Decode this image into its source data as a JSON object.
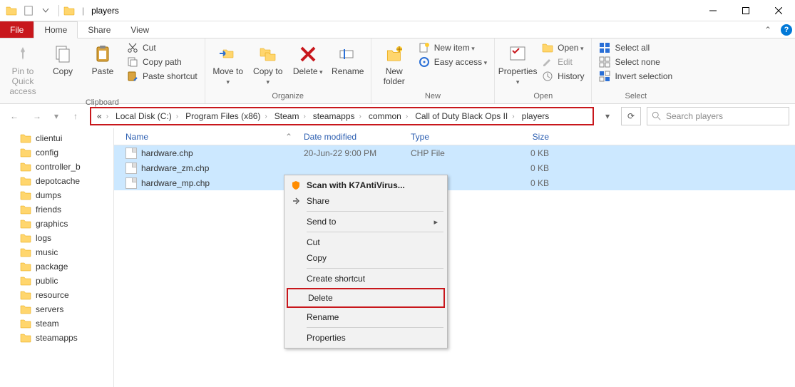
{
  "window": {
    "title": "players",
    "title_sep": "|"
  },
  "tabs": {
    "file": "File",
    "home": "Home",
    "share": "Share",
    "view": "View"
  },
  "ribbon": {
    "clipboard": {
      "label": "Clipboard",
      "pin": "Pin to Quick access",
      "copy": "Copy",
      "paste": "Paste",
      "cut": "Cut",
      "copy_path": "Copy path",
      "paste_shortcut": "Paste shortcut"
    },
    "organize": {
      "label": "Organize",
      "move_to": "Move to",
      "copy_to": "Copy to",
      "delete": "Delete",
      "rename": "Rename"
    },
    "new": {
      "label": "New",
      "new_folder": "New folder",
      "new_item": "New item",
      "easy_access": "Easy access"
    },
    "open": {
      "label": "Open",
      "properties": "Properties",
      "open": "Open",
      "edit": "Edit",
      "history": "History"
    },
    "select": {
      "label": "Select",
      "select_all": "Select all",
      "select_none": "Select none",
      "invert": "Invert selection"
    }
  },
  "breadcrumbs": [
    "Local Disk (C:)",
    "Program Files (x86)",
    "Steam",
    "steamapps",
    "common",
    "Call of Duty Black Ops II",
    "players"
  ],
  "search": {
    "placeholder": "Search players"
  },
  "sidebar": [
    "clientui",
    "config",
    "controller_b",
    "depotcache",
    "dumps",
    "friends",
    "graphics",
    "logs",
    "music",
    "package",
    "public",
    "resource",
    "servers",
    "steam",
    "steamapps"
  ],
  "columns": {
    "name": "Name",
    "date": "Date modified",
    "type": "Type",
    "size": "Size"
  },
  "files": [
    {
      "name": "hardware.chp",
      "date": "20-Jun-22 9:00 PM",
      "type": "CHP File",
      "size": "0 KB"
    },
    {
      "name": "hardware_zm.chp",
      "date": "",
      "type": "",
      "size": "0 KB"
    },
    {
      "name": "hardware_mp.chp",
      "date": "",
      "type": "",
      "size": "0 KB"
    }
  ],
  "context_menu": {
    "scan": "Scan with K7AntiVirus...",
    "share": "Share",
    "send_to": "Send to",
    "cut": "Cut",
    "copy": "Copy",
    "create_shortcut": "Create shortcut",
    "delete": "Delete",
    "rename": "Rename",
    "properties": "Properties"
  }
}
